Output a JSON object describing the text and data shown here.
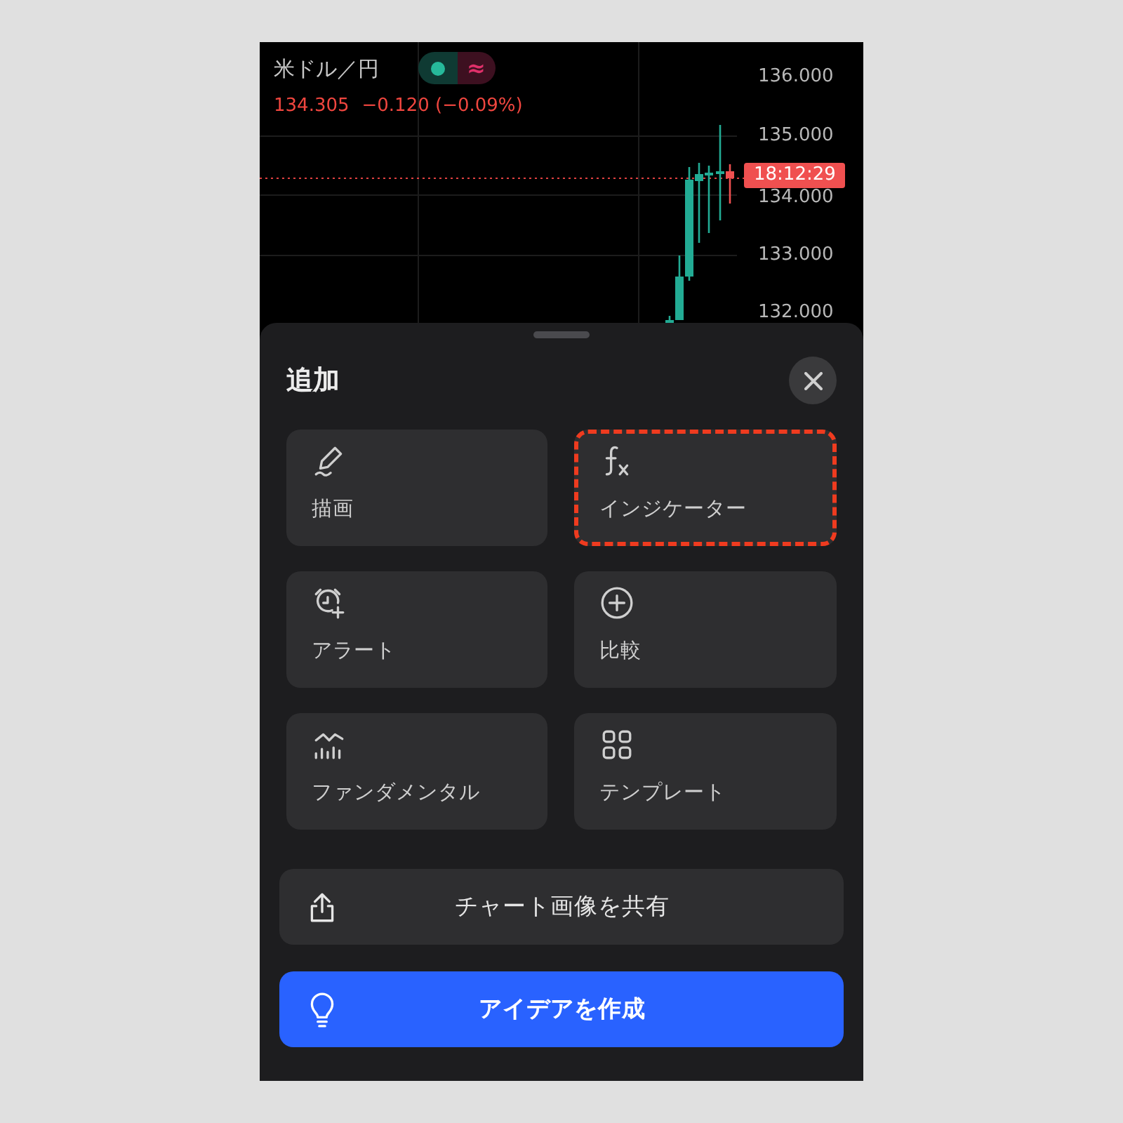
{
  "chart": {
    "symbol": "米ドル／円",
    "status_glyph": "≈",
    "price": "134.305",
    "change": "−0.120 (−0.09%)",
    "price_axis": [
      "136.000",
      "135.000",
      "134.000",
      "133.000",
      "132.000"
    ],
    "time_label": "18:12:29"
  },
  "sheet": {
    "title": "追加",
    "tiles": [
      {
        "label": "描画",
        "kind": "pen",
        "highlighted": false
      },
      {
        "label": "インジケーター",
        "kind": "function",
        "highlighted": true
      },
      {
        "label": "アラート",
        "kind": "alarm",
        "highlighted": false
      },
      {
        "label": "比較",
        "kind": "plus",
        "highlighted": false
      },
      {
        "label": "ファンダメンタル",
        "kind": "bars",
        "highlighted": false
      },
      {
        "label": "テンプレート",
        "kind": "grid",
        "highlighted": false
      }
    ],
    "buttons": [
      {
        "label": "チャート画像を共有",
        "kind": "share",
        "primary": false
      },
      {
        "label": "アイデアを作成",
        "kind": "idea",
        "primary": true
      }
    ]
  }
}
